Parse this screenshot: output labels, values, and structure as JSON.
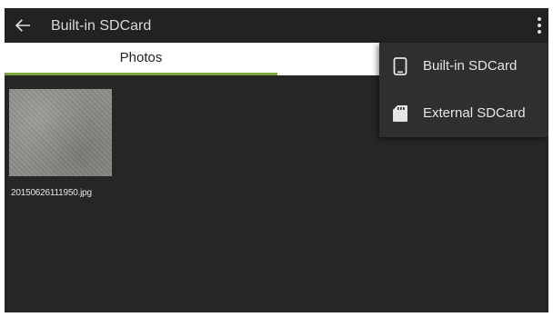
{
  "appbar": {
    "title": "Built-in SDCard",
    "back_icon": "arrow-left-icon",
    "overflow_icon": "more-vertical-icon"
  },
  "tabs": [
    {
      "label": "Photos",
      "selected": true
    }
  ],
  "files": [
    {
      "name": "20150626111950.jpg"
    }
  ],
  "menu": {
    "items": [
      {
        "label": "Built-in SDCard",
        "icon": "phone-icon"
      },
      {
        "label": "External SDCard",
        "icon": "sd-card-icon"
      }
    ]
  },
  "colors": {
    "background": "#262626",
    "appbar": "#222222",
    "tab_background": "#ffffff",
    "tab_indicator": "#7ea53a",
    "menu_background": "#2f2f2f",
    "text_light": "#e6e6e6"
  }
}
